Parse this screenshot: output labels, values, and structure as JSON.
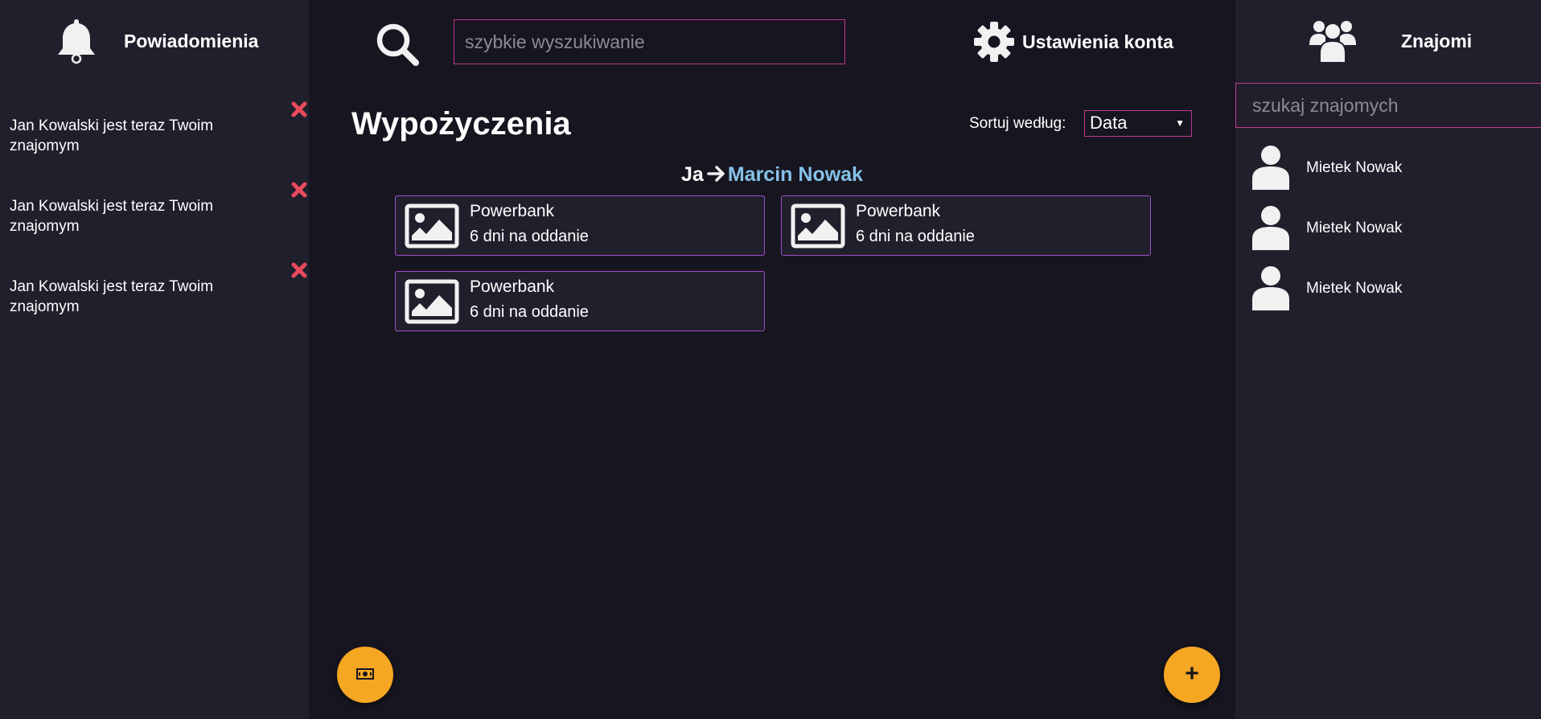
{
  "notifications": {
    "title": "Powiadomienia",
    "items": [
      {
        "text": "Jan Kowalski jest teraz Twoim znajomym"
      },
      {
        "text": "Jan Kowalski jest teraz Twoim znajomym"
      },
      {
        "text": "Jan Kowalski jest teraz Twoim znajomym"
      }
    ]
  },
  "header": {
    "search_placeholder": "szybkie wyszukiwanie",
    "search_value": "",
    "settings_label": "Ustawienia konta"
  },
  "main": {
    "title": "Wypożyczenia",
    "sort_label": "Sortuj według:",
    "sort_value": "Data",
    "group": {
      "from": "Ja",
      "to": "Marcin Nowak"
    },
    "loans": [
      {
        "name": "Powerbank",
        "status": "6 dni na oddanie"
      },
      {
        "name": "Powerbank",
        "status": "6 dni na oddanie"
      },
      {
        "name": "Powerbank",
        "status": "6 dni na oddanie"
      }
    ]
  },
  "friends": {
    "title": "Znajomi",
    "search_placeholder": "szukaj znajomych",
    "search_value": "",
    "items": [
      {
        "name": "Mietek Nowak"
      },
      {
        "name": "Mietek Nowak"
      },
      {
        "name": "Mietek Nowak"
      }
    ]
  },
  "colors": {
    "side_bg": "#211f2c",
    "main_bg": "#17151f",
    "input_border": "#c0398e",
    "card_border": "#9c4fc9",
    "close_red": "#e94b5c",
    "link_blue": "#86c1e8",
    "fab_orange": "#f5a623"
  },
  "icons": {
    "notifications": "bell-icon",
    "notification_dismiss": "close-icon",
    "search": "search-icon",
    "settings": "gear-icon",
    "transfer": "arrow-right-icon",
    "loan_item": "image-placeholder-icon",
    "money_button": "money-icon",
    "add_button": "plus-icon",
    "friends": "friends-icon",
    "friend": "user-avatar-icon"
  }
}
